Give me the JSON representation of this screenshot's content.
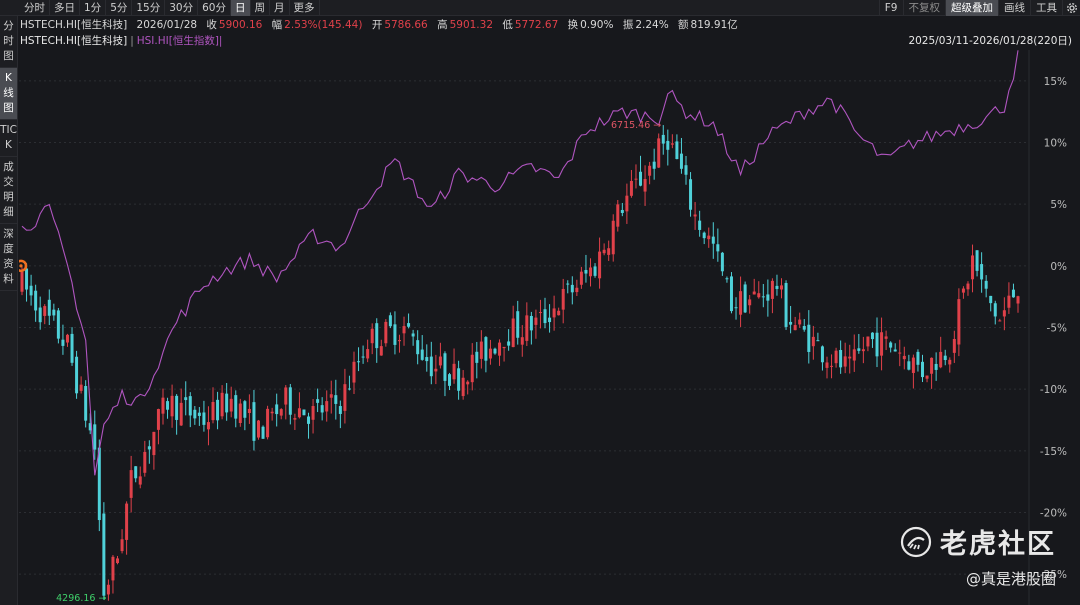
{
  "toolbar": {
    "periods": [
      "分时",
      "多日",
      "1分",
      "5分",
      "15分",
      "30分",
      "60分",
      "日",
      "周",
      "月",
      "更多"
    ],
    "active_period": "日",
    "right": [
      "F9",
      "不复权",
      "超级叠加",
      "画线",
      "工具"
    ],
    "active_right": "超级叠加"
  },
  "sidebar": {
    "tabs": [
      "分时图",
      "K线图",
      "TICK",
      "成交明细",
      "深度资料"
    ],
    "active": "K线图"
  },
  "info": {
    "name": "HSTECH.HI[恒生科技]",
    "date": "2026/01/28",
    "close_label": "收",
    "close": "5900.16",
    "change_label": "幅",
    "change": "2.53%(145.44)",
    "open_label": "开",
    "open": "5786.66",
    "high_label": "高",
    "high": "5901.32",
    "low_label": "低",
    "low": "5772.67",
    "turnover_label": "换",
    "turnover": "0.90%",
    "amplitude_label": "振",
    "amplitude": "2.24%",
    "amount_label": "额",
    "amount": "819.91亿"
  },
  "legend": {
    "main": "HSTECH.HI[恒生科技]",
    "separator": "|",
    "overlay": "HSI.HI[恒生指数]",
    "overlay_close": "|",
    "range": "2025/03/11-2026/01/28(220日)"
  },
  "watermark": {
    "title": "老虎社区",
    "handle": "@真是港股圈"
  },
  "colors": {
    "background": "#17181c",
    "up": "#e0414a",
    "down": "#4fd1d9",
    "overlay_line": "#b055c0",
    "grid": "#2c2e33",
    "low_marker": "#3fcf6a",
    "high_marker": "#e05565",
    "start_marker": "#f07020"
  },
  "chart_data": {
    "type": "candlestick",
    "percent_axis": {
      "labels": [
        "15%",
        "10%",
        "5%",
        "0%",
        "-5%",
        "-10%",
        "-15%",
        "-20%",
        "-25%"
      ],
      "values": [
        15,
        10,
        5,
        0,
        -5,
        -10,
        -15,
        -20,
        -25
      ],
      "range": [
        -27.5,
        17.5
      ]
    },
    "annotations": {
      "high_label": "6715.46",
      "low_label": "4296.16"
    },
    "start_marker_icon": "start-marker-icon",
    "series": [
      {
        "name": "HSTECH.HI[恒生科技]",
        "base": 5900.16,
        "ohlc_pct_segments": [
          [
            0,
            -1.5
          ],
          [
            10,
            -6.5
          ],
          [
            16,
            -14.8
          ],
          [
            18,
            -26.5
          ],
          [
            21,
            -23.5
          ],
          [
            24,
            -17.5
          ],
          [
            32,
            -11.0
          ],
          [
            40,
            -12.5
          ],
          [
            46,
            -10.8
          ],
          [
            52,
            -13.5
          ],
          [
            58,
            -11.0
          ],
          [
            64,
            -12.0
          ],
          [
            70,
            -11.0
          ],
          [
            76,
            -6.0
          ],
          [
            84,
            -5.0
          ],
          [
            90,
            -8.0
          ],
          [
            96,
            -9.0
          ],
          [
            106,
            -5.5
          ],
          [
            114,
            -4.5
          ],
          [
            126,
            0.0
          ],
          [
            132,
            5.0
          ],
          [
            138,
            8.0
          ],
          [
            142,
            10.5
          ],
          [
            145,
            7.5
          ],
          [
            148,
            4.0
          ],
          [
            152,
            1.5
          ],
          [
            156,
            -3.0
          ],
          [
            162,
            -2.5
          ],
          [
            166,
            -1.5
          ],
          [
            168,
            -4.0
          ],
          [
            172,
            -5.5
          ],
          [
            178,
            -7.5
          ],
          [
            182,
            -8.5
          ],
          [
            186,
            -6.0
          ],
          [
            192,
            -6.5
          ],
          [
            198,
            -8.5
          ],
          [
            204,
            -6.5
          ],
          [
            209,
            0.5
          ],
          [
            212,
            -2.5
          ],
          [
            215,
            -4.5
          ],
          [
            219,
            -1.5
          ]
        ]
      },
      {
        "name": "HSI.HI[恒生指数]",
        "pct_points": [
          [
            0,
            3.0
          ],
          [
            6,
            4.5
          ],
          [
            10,
            0.0
          ],
          [
            14,
            -6.0
          ],
          [
            16,
            -17.0
          ],
          [
            18,
            -13.0
          ],
          [
            22,
            -10.5
          ],
          [
            26,
            -11.0
          ],
          [
            34,
            -4.5
          ],
          [
            40,
            -1.5
          ],
          [
            44,
            -0.5
          ],
          [
            50,
            0.5
          ],
          [
            56,
            -1.0
          ],
          [
            64,
            2.5
          ],
          [
            70,
            1.5
          ],
          [
            76,
            5.5
          ],
          [
            82,
            8.5
          ],
          [
            90,
            4.5
          ],
          [
            96,
            7.5
          ],
          [
            104,
            6.5
          ],
          [
            112,
            8.0
          ],
          [
            118,
            7.0
          ],
          [
            124,
            11.0
          ],
          [
            132,
            12.5
          ],
          [
            140,
            12.0
          ],
          [
            142,
            14.0
          ],
          [
            146,
            12.5
          ],
          [
            152,
            11.5
          ],
          [
            158,
            7.5
          ],
          [
            164,
            10.5
          ],
          [
            172,
            12.5
          ],
          [
            178,
            13.5
          ],
          [
            184,
            10.5
          ],
          [
            190,
            8.5
          ],
          [
            196,
            10.0
          ],
          [
            204,
            11.0
          ],
          [
            212,
            12.0
          ],
          [
            216,
            13.0
          ],
          [
            219,
            17.0
          ]
        ]
      }
    ]
  }
}
